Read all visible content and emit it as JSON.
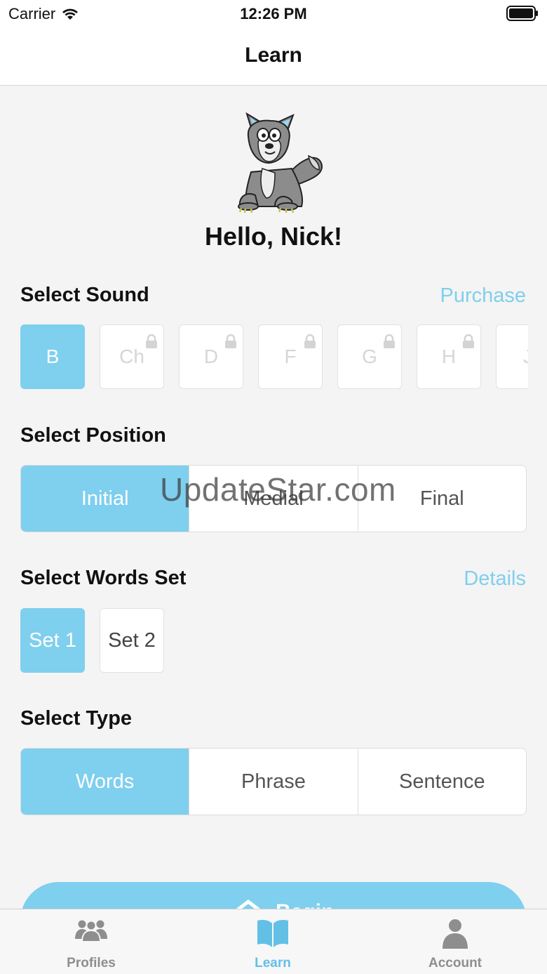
{
  "status_bar": {
    "carrier": "Carrier",
    "time": "12:26 PM"
  },
  "nav": {
    "title": "Learn"
  },
  "greeting": "Hello, Nick!",
  "sound": {
    "title": "Select Sound",
    "purchase_label": "Purchase",
    "items": [
      {
        "label": "B",
        "locked": false,
        "selected": true
      },
      {
        "label": "Ch",
        "locked": true,
        "selected": false
      },
      {
        "label": "D",
        "locked": true,
        "selected": false
      },
      {
        "label": "F",
        "locked": true,
        "selected": false
      },
      {
        "label": "G",
        "locked": true,
        "selected": false
      },
      {
        "label": "H",
        "locked": true,
        "selected": false
      },
      {
        "label": "J",
        "locked": true,
        "selected": false
      }
    ]
  },
  "position": {
    "title": "Select Position",
    "options": [
      "Initial",
      "Medial",
      "Final"
    ],
    "selected": "Initial"
  },
  "words_set": {
    "title": "Select Words Set",
    "details_label": "Details",
    "sets": [
      "Set 1",
      "Set 2"
    ],
    "selected": "Set 1"
  },
  "type": {
    "title": "Select Type",
    "options": [
      "Words",
      "Phrase",
      "Sentence"
    ],
    "selected": "Words"
  },
  "watermark": "UpdateStar.com",
  "start_button": {
    "label": "Begin",
    "icon": "house-icon"
  },
  "tab_bar": {
    "items": [
      {
        "label": "Profiles",
        "icon": "people-icon",
        "active": false
      },
      {
        "label": "Learn",
        "icon": "book-icon",
        "active": true
      },
      {
        "label": "Account",
        "icon": "person-icon",
        "active": false
      }
    ]
  },
  "colors": {
    "accent": "#7fcfee",
    "tab_active": "#62c0e6",
    "background": "#f4f4f4"
  }
}
